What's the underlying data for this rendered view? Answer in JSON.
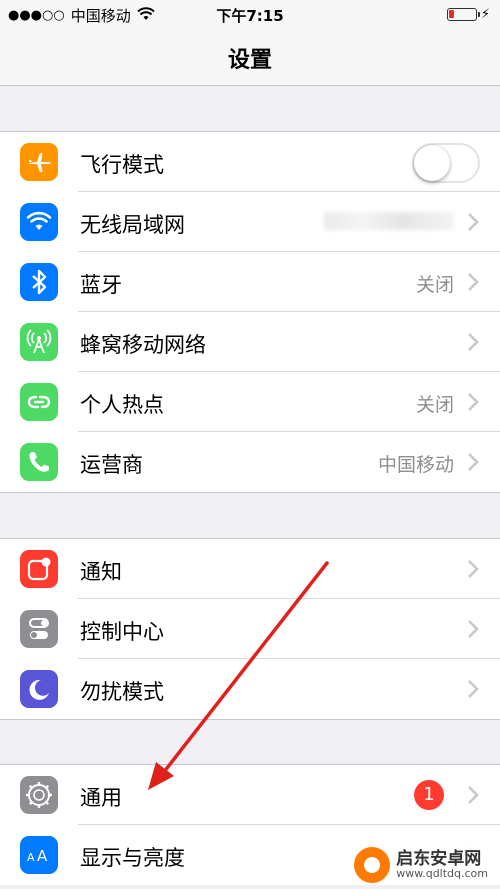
{
  "status_bar": {
    "signal": "●●●○○",
    "carrier": "中国移动",
    "wifi_icon": "wifi-icon",
    "time": "下午7:15",
    "battery_level": 0.1,
    "charging_icon": "bolt-icon"
  },
  "nav": {
    "title": "设置"
  },
  "groups": [
    {
      "rows": [
        {
          "label": "飞行模式",
          "icon": "airplane-icon",
          "icon_color": "#ff9500",
          "accessory": "toggle",
          "toggle_on": false
        },
        {
          "label": "无线局域网",
          "icon": "wifi-icon",
          "icon_color": "#007aff",
          "accessory": "blurred-value"
        },
        {
          "label": "蓝牙",
          "icon": "bluetooth-icon",
          "icon_color": "#007aff",
          "value": "关闭"
        },
        {
          "label": "蜂窝移动网络",
          "icon": "antenna-icon",
          "icon_color": "#4cd964"
        },
        {
          "label": "个人热点",
          "icon": "hotspot-icon",
          "icon_color": "#4cd964",
          "value": "关闭"
        },
        {
          "label": "运营商",
          "icon": "phone-icon",
          "icon_color": "#4cd964",
          "value": "中国移动"
        }
      ]
    },
    {
      "rows": [
        {
          "label": "通知",
          "icon": "notification-icon",
          "icon_color": "#ff3b30"
        },
        {
          "label": "控制中心",
          "icon": "control-center-icon",
          "icon_color": "#8e8e93"
        },
        {
          "label": "勿扰模式",
          "icon": "moon-icon",
          "icon_color": "#5856d6"
        }
      ]
    },
    {
      "rows": [
        {
          "label": "通用",
          "icon": "gear-icon",
          "icon_color": "#8e8e93",
          "badge": "1"
        },
        {
          "label": "显示与亮度",
          "icon": "text-size-icon",
          "icon_color": "#007aff"
        }
      ]
    }
  ],
  "annotation": {
    "arrow_color": "#e0201b"
  },
  "watermark": {
    "name": "启东安卓网",
    "url": "www.qdltdq.com"
  }
}
